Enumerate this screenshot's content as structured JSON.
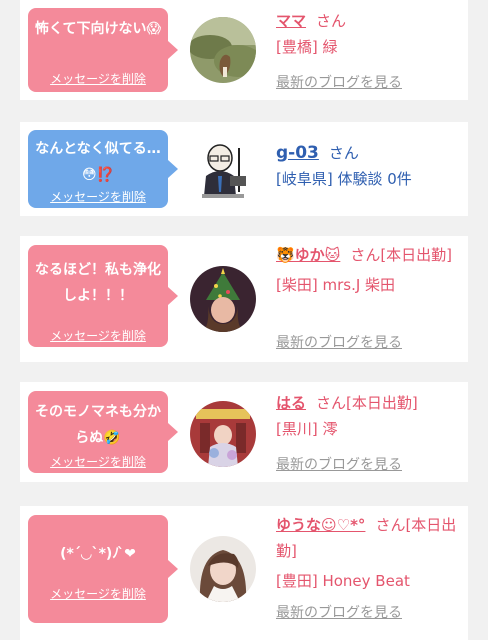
{
  "entries": [
    {
      "message": "怖くて下向けない😱",
      "delete_label": "メッセージを削除",
      "name": "ママ",
      "suffix": "さん",
      "detail": "[豊橋] 緑",
      "blog_link": "最新のブログを見る",
      "bubble_color": "#f48a9a"
    },
    {
      "message": "なんとなく似てる…😳⁉️",
      "delete_label": "メッセージを削除",
      "name": "g-03",
      "suffix": "さん",
      "detail": "[岐阜県] 体験談 0件",
      "bubble_color": "#6fa8e9"
    },
    {
      "message": "なるほど！私も浄化しよ！！！",
      "delete_label": "メッセージを削除",
      "name": "🐯ゆか🐱",
      "suffix": "さん[本日出勤]",
      "detail": "[柴田] mrs.J 柴田",
      "blog_link": "最新のブログを見る",
      "bubble_color": "#f48a9a"
    },
    {
      "message": "そのモノマネも分からぬ🤣",
      "delete_label": "メッセージを削除",
      "name": "はる",
      "suffix": "さん[本日出勤]",
      "detail": "[黒川] 澪",
      "blog_link": "最新のブログを見る",
      "bubble_color": "#f48a9a"
    },
    {
      "message": "(*´◡`*)ﾉ ̀❤",
      "delete_label": "メッセージを削除",
      "name": "ゆうな☺︎♡*°",
      "suffix": "さん[本日出勤]",
      "detail": "[豊田] Honey Beat",
      "blog_link": "最新のブログを見る",
      "bubble_color": "#f48a9a"
    }
  ]
}
